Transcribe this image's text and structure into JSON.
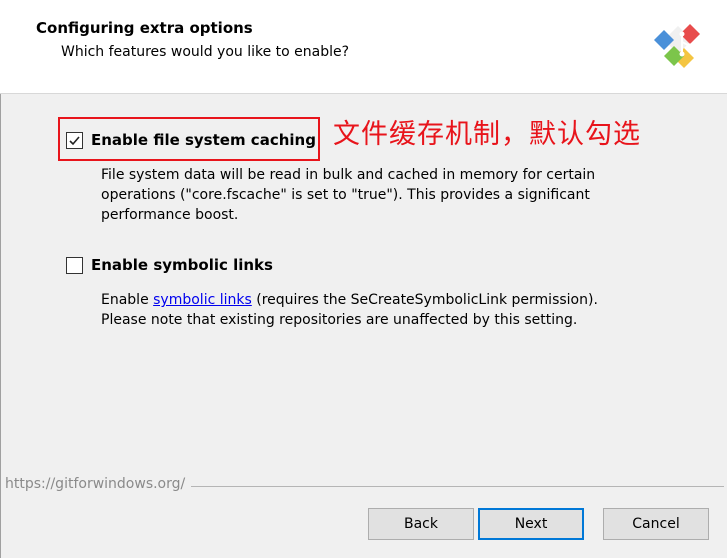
{
  "header": {
    "title": "Configuring extra options",
    "subtitle": "Which features would you like to enable?"
  },
  "options": [
    {
      "label": "Enable file system caching",
      "checked": true,
      "description": [
        "File system data will be read in bulk and cached in memory for certain",
        "operations (\"core.fscache\" is set to \"true\"). This provides a significant",
        "performance boost."
      ]
    },
    {
      "label": "Enable symbolic links",
      "checked": false,
      "description_prefix": "Enable ",
      "description_link": "symbolic links",
      "description_suffix": " (requires the SeCreateSymbolicLink permission).",
      "description_line2": "Please note that existing repositories are unaffected by this setting."
    }
  ],
  "annotation": "文件缓存机制，默认勾选",
  "footer_url": "https://gitforwindows.org/",
  "buttons": {
    "back": "Back",
    "next": "Next",
    "cancel": "Cancel"
  },
  "colors": {
    "annotation": "#e8141b",
    "link": "#0000ee",
    "default_button_border": "#0078d7"
  },
  "icons": [
    "git-logo-icon",
    "checkmark-icon"
  ]
}
